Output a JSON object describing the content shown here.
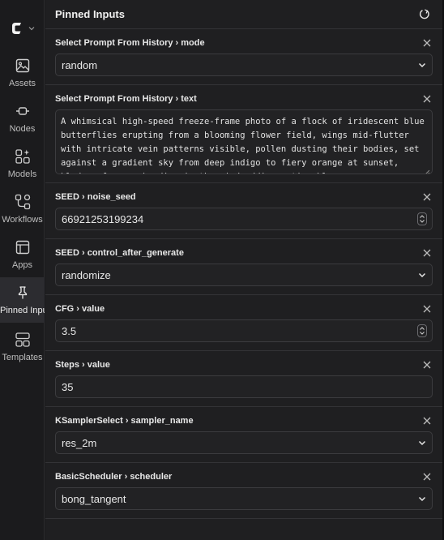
{
  "sidebar": {
    "items": [
      {
        "label": "Assets",
        "icon": "image-icon"
      },
      {
        "label": "Nodes",
        "icon": "node-icon"
      },
      {
        "label": "Models",
        "icon": "models-icon"
      },
      {
        "label": "Workflows",
        "icon": "workflow-icon"
      },
      {
        "label": "Apps",
        "icon": "apps-icon"
      },
      {
        "label": "Pinned Inputs",
        "icon": "pin-icon",
        "active": true
      },
      {
        "label": "Templates",
        "icon": "templates-icon"
      }
    ]
  },
  "panel": {
    "title": "Pinned Inputs",
    "sections": [
      {
        "title": "Select Prompt From History › mode",
        "type": "select",
        "value": "random"
      },
      {
        "title": "Select Prompt From History › text",
        "type": "textarea",
        "value": "A whimsical high-speed freeze-frame photo of a flock of iridescent blue butterflies erupting from a blooming flower field, wings mid-flutter with intricate vein patterns visible, pollen dusting their bodies, set against a gradient sky from deep indigo to fiery orange at sunset, blades of grass bending in the wind adding motion blur"
      },
      {
        "title": "SEED › noise_seed",
        "type": "number",
        "value": "66921253199234"
      },
      {
        "title": "SEED › control_after_generate",
        "type": "select",
        "value": "randomize"
      },
      {
        "title": "CFG › value",
        "type": "number",
        "value": "3.5"
      },
      {
        "title": "Steps › value",
        "type": "number",
        "value": "35"
      },
      {
        "title": "KSamplerSelect › sampler_name",
        "type": "select",
        "value": "res_2m"
      },
      {
        "title": "BasicScheduler › scheduler",
        "type": "select",
        "value": "bong_tangent"
      }
    ]
  },
  "colors": {
    "background": "#1f1f21",
    "rail": "#1b1b1d",
    "active": "#2c2c30",
    "border": "#3c3c3f"
  }
}
